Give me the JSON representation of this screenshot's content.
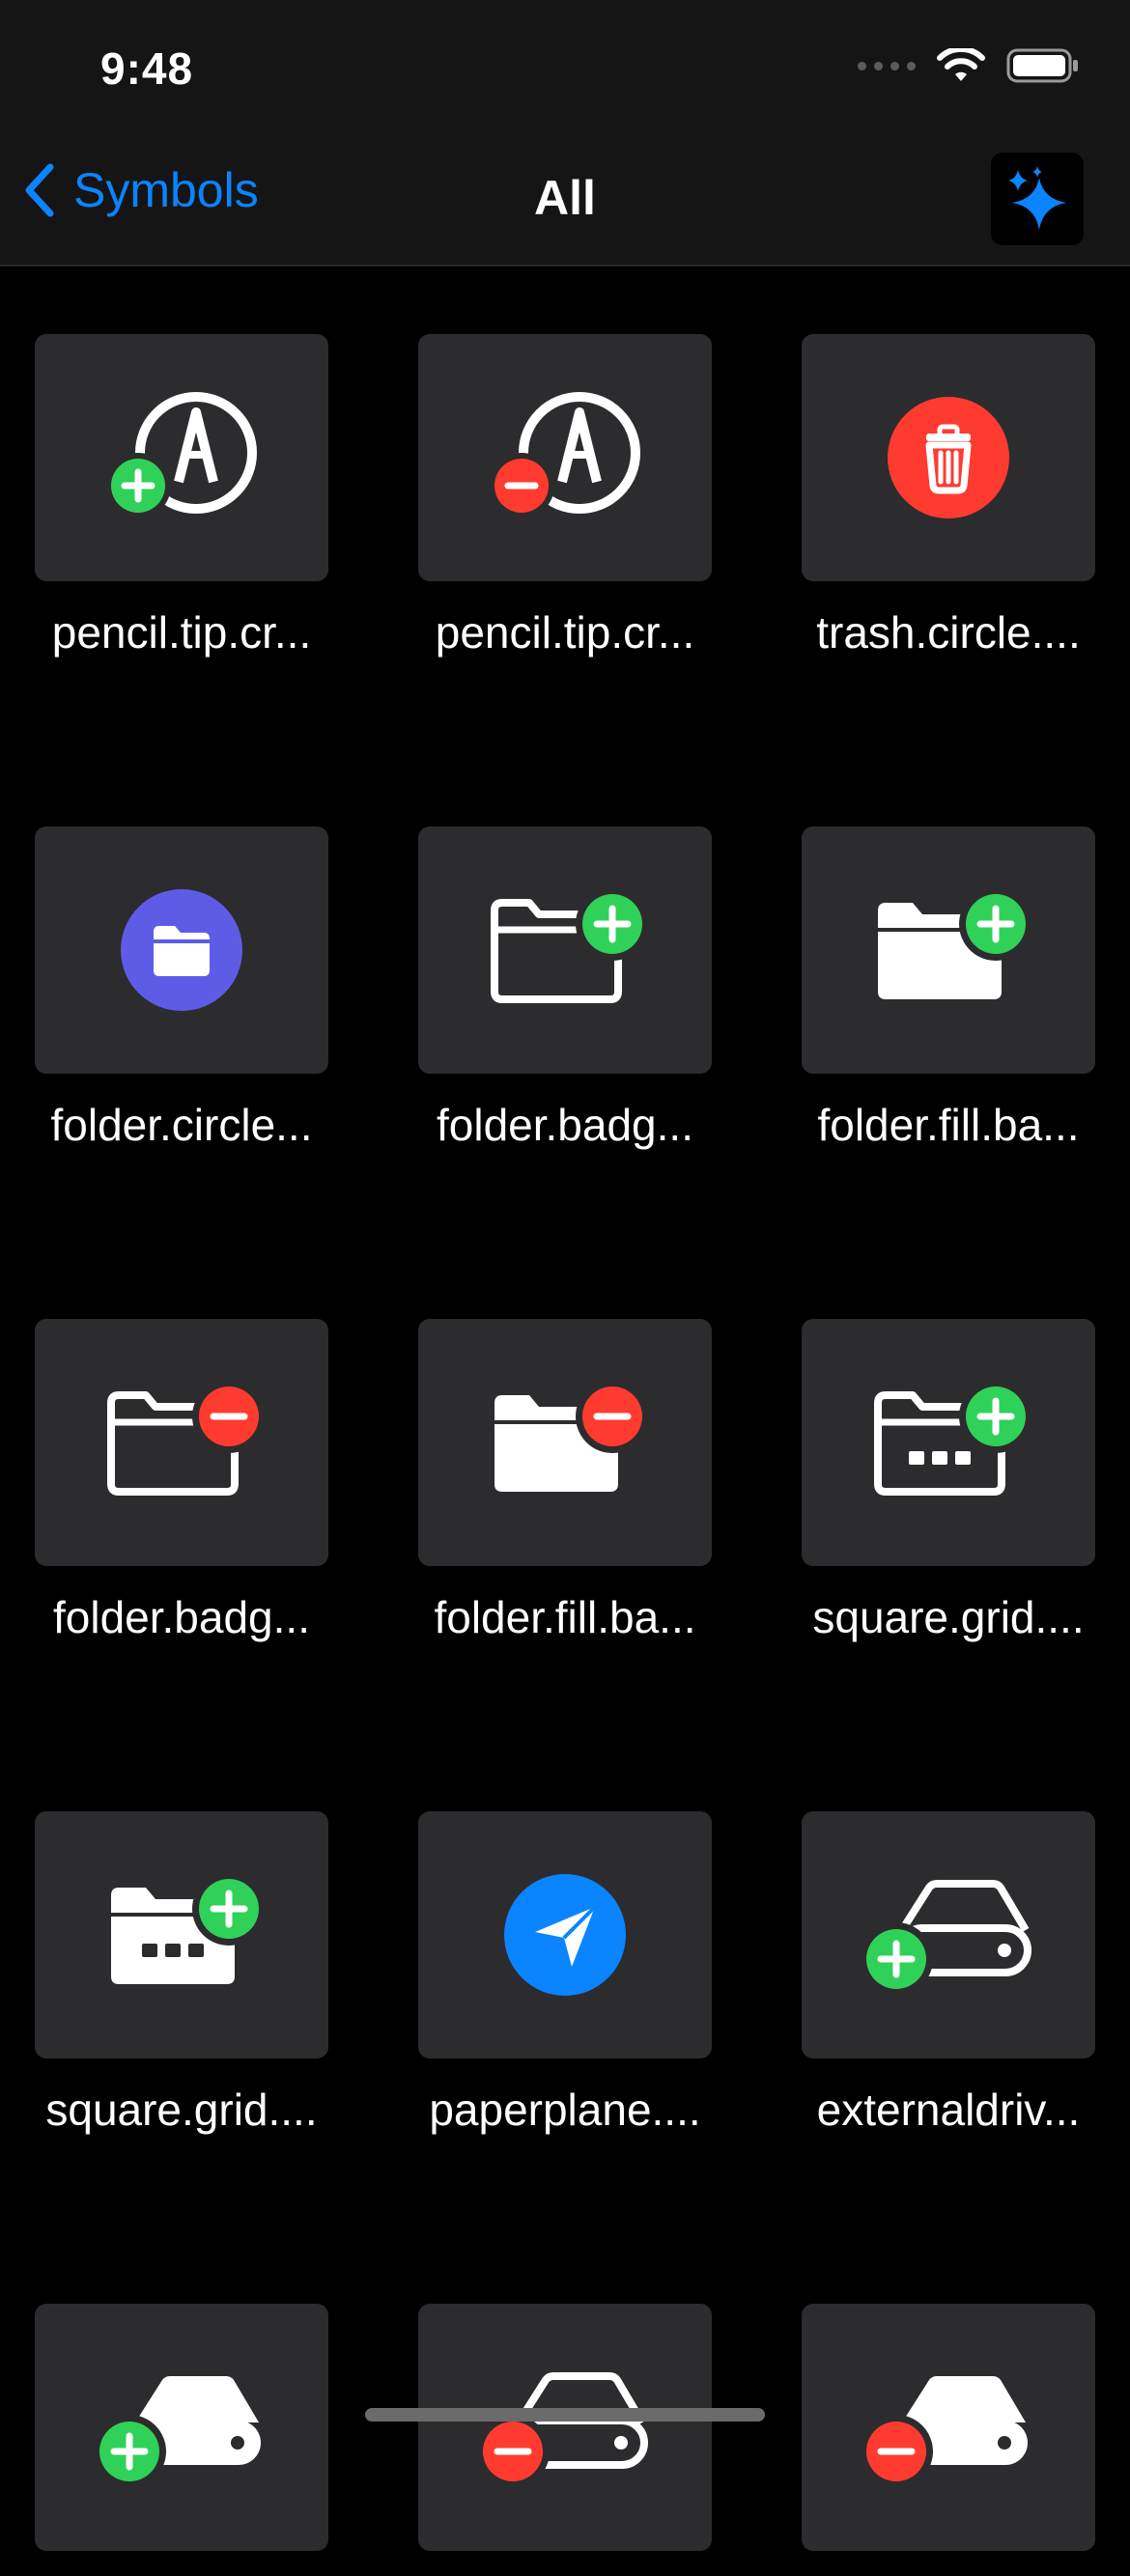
{
  "status_bar": {
    "time": "9:48"
  },
  "nav": {
    "back_label": "Symbols",
    "title": "All"
  },
  "colors": {
    "accent": "#0a84ff",
    "green": "#30d158",
    "red": "#ff3b30",
    "indigo": "#5e5ce6",
    "tile": "#2c2c2e"
  },
  "grid": {
    "items": [
      {
        "label": "pencil.tip.cr...",
        "icon": "pencil-tip-crop-circle-badge-plus-icon"
      },
      {
        "label": "pencil.tip.cr...",
        "icon": "pencil-tip-crop-circle-badge-minus-icon"
      },
      {
        "label": "trash.circle....",
        "icon": "trash-circle-fill-icon"
      },
      {
        "label": "folder.circle...",
        "icon": "folder-circle-fill-icon"
      },
      {
        "label": "folder.badg...",
        "icon": "folder-badge-plus-icon"
      },
      {
        "label": "folder.fill.ba...",
        "icon": "folder-fill-badge-plus-icon"
      },
      {
        "label": "folder.badg...",
        "icon": "folder-badge-minus-icon"
      },
      {
        "label": "folder.fill.ba...",
        "icon": "folder-fill-badge-minus-icon"
      },
      {
        "label": "square.grid....",
        "icon": "square-grid-folder-badge-plus-icon"
      },
      {
        "label": "square.grid....",
        "icon": "square-grid-folder-fill-badge-plus-icon"
      },
      {
        "label": "paperplane....",
        "icon": "paperplane-circle-fill-icon"
      },
      {
        "label": "externaldriv...",
        "icon": "externaldrive-badge-plus-icon"
      },
      {
        "label": "",
        "icon": "externaldrive-fill-badge-plus-icon"
      },
      {
        "label": "",
        "icon": "externaldrive-badge-minus-icon"
      },
      {
        "label": "",
        "icon": "externaldrive-fill-badge-minus-icon"
      }
    ]
  }
}
